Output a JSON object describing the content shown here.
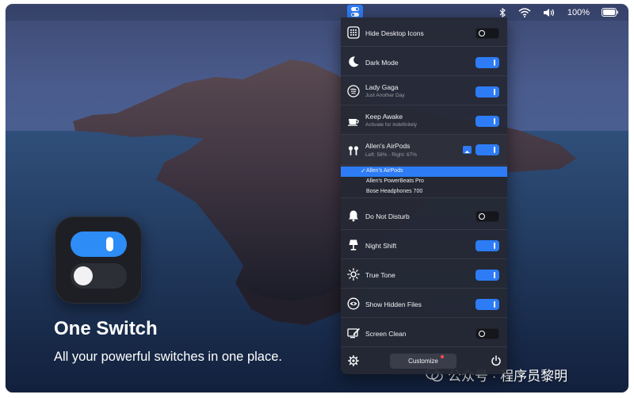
{
  "menubar": {
    "battery": "100%",
    "icons": [
      "one-switch-icon",
      "bluetooth-icon",
      "wifi-icon",
      "volume-icon",
      "battery-icon"
    ]
  },
  "hero": {
    "title": "One Switch",
    "subtitle": "All your powerful switches in one place."
  },
  "panel": {
    "items": [
      {
        "label": "Hide Desktop Icons",
        "sub": "",
        "icon": "grid-icon",
        "on": false
      },
      {
        "label": "Dark Mode",
        "sub": "",
        "icon": "moon-icon",
        "on": true
      },
      {
        "label": "Lady Gaga",
        "sub": "Just Another Day",
        "icon": "music-icon",
        "on": true
      },
      {
        "label": "Keep Awake",
        "sub": "Activate for indefinitely",
        "icon": "coffee-icon",
        "on": true
      },
      {
        "label": "Allen's AirPods",
        "sub": "Left: 58% - Right: 67%",
        "icon": "airpods-icon",
        "on": true
      },
      {
        "label": "Do Not Disturb",
        "sub": "",
        "icon": "bell-icon",
        "on": false
      },
      {
        "label": "Night Shift",
        "sub": "",
        "icon": "lamp-icon",
        "on": true
      },
      {
        "label": "True Tone",
        "sub": "",
        "icon": "sun-icon",
        "on": true
      },
      {
        "label": "Show Hidden Files",
        "sub": "",
        "icon": "eye-icon",
        "on": true
      },
      {
        "label": "Screen Clean",
        "sub": "",
        "icon": "screen-clean-icon",
        "on": false
      }
    ],
    "audio_devices": [
      {
        "name": "Allen's AirPods",
        "selected": true
      },
      {
        "name": "Allen's PowerBeats Pro",
        "selected": false
      },
      {
        "name": "Bose Headphones 700",
        "selected": false
      }
    ],
    "footer": {
      "customize": "Customize"
    }
  },
  "watermark": "公众号 · 程序员黎明",
  "colors": {
    "accent": "#2d7cf6",
    "panel_bg": "#252834",
    "text": "#f2f2f4",
    "subtext": "#9a9ca6"
  }
}
